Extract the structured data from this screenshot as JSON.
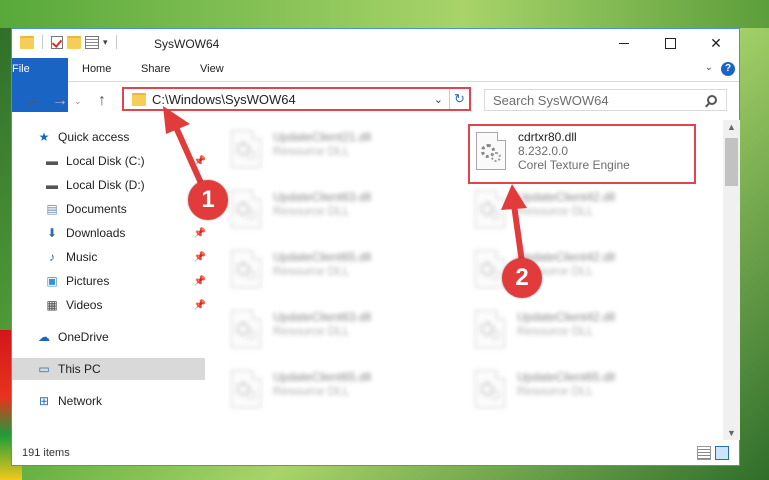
{
  "window": {
    "title": "SysWOW64",
    "controls": {
      "minimize": "",
      "maximize": "",
      "close": "✕"
    }
  },
  "ribbon": {
    "tabs": [
      "File",
      "Home",
      "Share",
      "View"
    ],
    "help": "?"
  },
  "address": {
    "path": "C:\\Windows\\SysWOW64",
    "search_placeholder": "Search SysWOW64"
  },
  "sidebar": {
    "items": [
      {
        "label": "Quick access",
        "icon": "star-icon",
        "pinned": false
      },
      {
        "label": "Local Disk (C:)",
        "icon": "drive-icon",
        "pinned": true
      },
      {
        "label": "Local Disk (D:)",
        "icon": "drive-icon",
        "pinned": false
      },
      {
        "label": "Documents",
        "icon": "documents-icon",
        "pinned": true
      },
      {
        "label": "Downloads",
        "icon": "download-icon",
        "pinned": true
      },
      {
        "label": "Music",
        "icon": "music-icon",
        "pinned": true
      },
      {
        "label": "Pictures",
        "icon": "pictures-icon",
        "pinned": true
      },
      {
        "label": "Videos",
        "icon": "videos-icon",
        "pinned": true
      },
      {
        "label": "OneDrive",
        "icon": "cloud-icon",
        "pinned": false
      },
      {
        "label": "This PC",
        "icon": "computer-icon",
        "pinned": false
      },
      {
        "label": "Network",
        "icon": "network-icon",
        "pinned": false
      }
    ]
  },
  "files": {
    "left": [
      {
        "name": "UpdateClient21.dll",
        "type": "Resource DLL"
      },
      {
        "name": "UpdateClient63.dll",
        "type": "Resource DLL"
      },
      {
        "name": "UpdateClient65.dll",
        "type": "Resource DLL"
      },
      {
        "name": "UpdateClient63.dll",
        "type": "Resource DLL"
      },
      {
        "name": "UpdateClient65.dll",
        "type": "Resource DLL"
      }
    ],
    "right": [
      {
        "name": "cdrtxr80.dll",
        "version": "8.232.0.0",
        "desc": "Corel Texture Engine"
      },
      {
        "name": "UpdateClient42.dll",
        "type": "Resource DLL"
      },
      {
        "name": "UpdateClient42.dll",
        "type": "Resource DLL"
      },
      {
        "name": "UpdateClient42.dll",
        "type": "Resource DLL"
      },
      {
        "name": "UpdateClient65.dll",
        "type": "Resource DLL"
      }
    ]
  },
  "status": {
    "items_count": "191 items"
  },
  "annotations": {
    "marker1": "1",
    "marker2": "2"
  },
  "colors": {
    "accent": "#1a64c4",
    "highlight": "#e0444c",
    "marker": "#e23b3b"
  }
}
